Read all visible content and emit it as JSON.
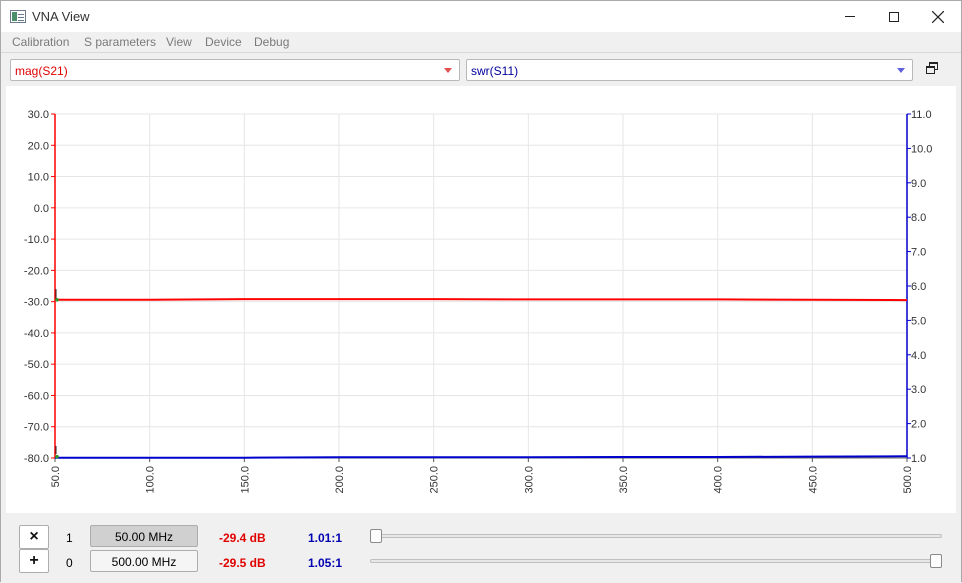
{
  "window": {
    "title": "VNA View"
  },
  "menu": [
    "Calibration",
    "S parameters",
    "View",
    "Device",
    "Debug"
  ],
  "selectors": {
    "left": "mag(S21)",
    "right": "swr(S11)"
  },
  "chart_data": {
    "type": "line",
    "x_ticks": [
      "50.0",
      "100.0",
      "150.0",
      "200.0",
      "250.0",
      "300.0",
      "350.0",
      "400.0",
      "450.0",
      "500.0"
    ],
    "y_left_ticks": [
      "30.0",
      "20.0",
      "10.0",
      "0.0",
      "-10.0",
      "-20.0",
      "-30.0",
      "-40.0",
      "-50.0",
      "-60.0",
      "-70.0",
      "-80.0"
    ],
    "y_right_ticks": [
      "11.0",
      "10.0",
      "9.0",
      "8.0",
      "7.0",
      "6.0",
      "5.0",
      "4.0",
      "3.0",
      "2.0",
      "1.0"
    ],
    "xlim": [
      50,
      500
    ],
    "ylim_left": [
      -80,
      30
    ],
    "ylim_right": [
      1,
      11
    ],
    "grid": true,
    "colors": {
      "left": "#ff0000",
      "right": "#0000cc"
    },
    "series": [
      {
        "name": "mag(S21)",
        "axis": "left",
        "x": [
          50,
          100,
          150,
          200,
          250,
          300,
          350,
          400,
          450,
          500
        ],
        "values": [
          -29.4,
          -29.4,
          -29.2,
          -29.2,
          -29.2,
          -29.3,
          -29.3,
          -29.3,
          -29.4,
          -29.5
        ]
      },
      {
        "name": "swr(S11)",
        "axis": "right",
        "x": [
          50,
          100,
          150,
          200,
          250,
          300,
          350,
          400,
          450,
          500
        ],
        "values": [
          1.01,
          1.01,
          1.01,
          1.02,
          1.02,
          1.02,
          1.03,
          1.03,
          1.04,
          1.05
        ]
      }
    ]
  },
  "markers": [
    {
      "button": "×",
      "index": "1",
      "freq": "50.00 MHz",
      "mag": "-29.4 dB",
      "swr": "1.01:1",
      "slider": 0.0
    },
    {
      "button": "+",
      "index": "0",
      "freq": "500.00 MHz",
      "mag": "-29.5 dB",
      "swr": "1.05:1",
      "slider": 1.0
    }
  ]
}
